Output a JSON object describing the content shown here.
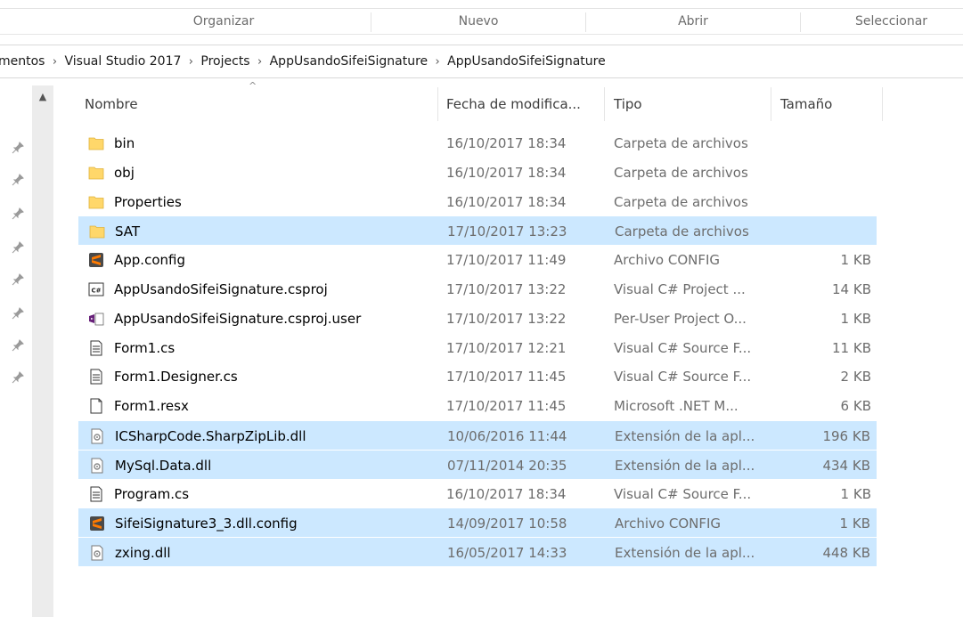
{
  "ribbon": {
    "groups": [
      {
        "label": "Organizar"
      },
      {
        "label": "Nuevo"
      },
      {
        "label": "Abrir"
      },
      {
        "label": "Seleccionar"
      }
    ]
  },
  "breadcrumb": [
    "mentos",
    "Visual Studio 2017",
    "Projects",
    "AppUsandoSifeiSignature",
    "AppUsandoSifeiSignature"
  ],
  "columns": {
    "name": "Nombre",
    "date": "Fecha de modifica...",
    "type": "Tipo",
    "size": "Tamaño"
  },
  "files": [
    {
      "name": "bin",
      "date": "16/10/2017 18:34",
      "type": "Carpeta de archivos",
      "size": "",
      "icon": "folder-icon",
      "selected": false
    },
    {
      "name": "obj",
      "date": "16/10/2017 18:34",
      "type": "Carpeta de archivos",
      "size": "",
      "icon": "folder-icon",
      "selected": false
    },
    {
      "name": "Properties",
      "date": "16/10/2017 18:34",
      "type": "Carpeta de archivos",
      "size": "",
      "icon": "folder-icon",
      "selected": false
    },
    {
      "name": "SAT",
      "date": "17/10/2017 13:23",
      "type": "Carpeta de archivos",
      "size": "",
      "icon": "folder-icon",
      "selected": true
    },
    {
      "name": "App.config",
      "date": "17/10/2017 11:49",
      "type": "Archivo CONFIG",
      "size": "1 KB",
      "icon": "sublime-config-icon",
      "selected": false
    },
    {
      "name": "AppUsandoSifeiSignature.csproj",
      "date": "17/10/2017 13:22",
      "type": "Visual C# Project ...",
      "size": "14 KB",
      "icon": "csharp-project-icon",
      "selected": false
    },
    {
      "name": "AppUsandoSifeiSignature.csproj.user",
      "date": "17/10/2017 13:22",
      "type": "Per-User Project O...",
      "size": "1 KB",
      "icon": "visual-studio-user-icon",
      "selected": false
    },
    {
      "name": "Form1.cs",
      "date": "17/10/2017 12:21",
      "type": "Visual C# Source F...",
      "size": "11 KB",
      "icon": "text-file-icon",
      "selected": false
    },
    {
      "name": "Form1.Designer.cs",
      "date": "17/10/2017 11:45",
      "type": "Visual C# Source F...",
      "size": "2 KB",
      "icon": "text-file-icon",
      "selected": false
    },
    {
      "name": "Form1.resx",
      "date": "17/10/2017 11:45",
      "type": "Microsoft .NET M...",
      "size": "6 KB",
      "icon": "blank-file-icon",
      "selected": false
    },
    {
      "name": "ICSharpCode.SharpZipLib.dll",
      "date": "10/06/2016 11:44",
      "type": "Extensión de la apl...",
      "size": "196 KB",
      "icon": "dll-file-icon",
      "selected": true
    },
    {
      "name": "MySql.Data.dll",
      "date": "07/11/2014 20:35",
      "type": "Extensión de la apl...",
      "size": "434 KB",
      "icon": "dll-file-icon",
      "selected": true
    },
    {
      "name": "Program.cs",
      "date": "16/10/2017 18:34",
      "type": "Visual C# Source F...",
      "size": "1 KB",
      "icon": "text-file-icon",
      "selected": false
    },
    {
      "name": "SifeiSignature3_3.dll.config",
      "date": "14/09/2017 10:58",
      "type": "Archivo CONFIG",
      "size": "1 KB",
      "icon": "sublime-config-icon",
      "selected": true
    },
    {
      "name": "zxing.dll",
      "date": "16/05/2017 14:33",
      "type": "Extensión de la apl...",
      "size": "448 KB",
      "icon": "dll-file-icon",
      "selected": true
    }
  ],
  "colors": {
    "selection": "#cce8ff",
    "folder": "#ffd76a",
    "sublime": "#ff7a00"
  }
}
